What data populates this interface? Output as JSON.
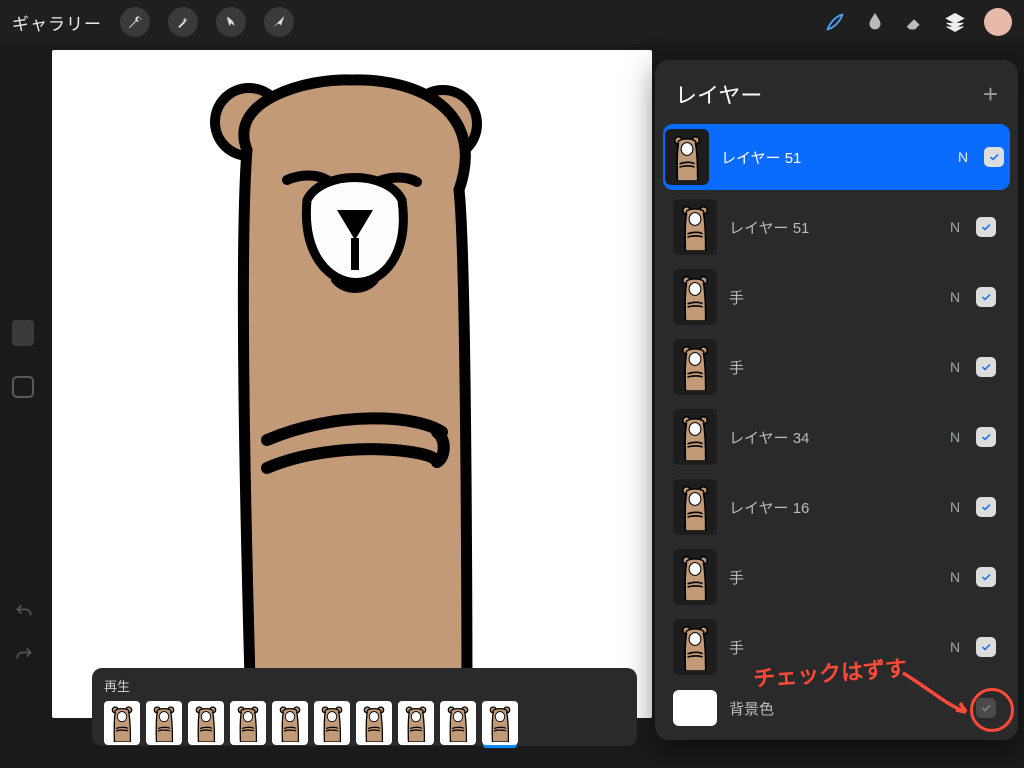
{
  "topbar": {
    "gallery": "ギャラリー",
    "color_swatch": "#e7b9ab"
  },
  "layers_panel": {
    "title": "レイヤー",
    "layers": [
      {
        "name": "レイヤー 51",
        "blend": "N",
        "visible": true,
        "selected": true
      },
      {
        "name": "レイヤー 51",
        "blend": "N",
        "visible": true,
        "selected": false
      },
      {
        "name": "手",
        "blend": "N",
        "visible": true,
        "selected": false
      },
      {
        "name": "手",
        "blend": "N",
        "visible": true,
        "selected": false
      },
      {
        "name": "レイヤー 34",
        "blend": "N",
        "visible": true,
        "selected": false
      },
      {
        "name": "レイヤー 16",
        "blend": "N",
        "visible": true,
        "selected": false
      },
      {
        "name": "手",
        "blend": "N",
        "visible": true,
        "selected": false
      },
      {
        "name": "手",
        "blend": "N",
        "visible": true,
        "selected": false
      }
    ],
    "background": {
      "label": "背景色",
      "visible": false
    }
  },
  "timeline": {
    "play_label": "再生",
    "frame_count": 10,
    "current_frame": 9
  },
  "annotation": {
    "text": "チェックはずす"
  }
}
